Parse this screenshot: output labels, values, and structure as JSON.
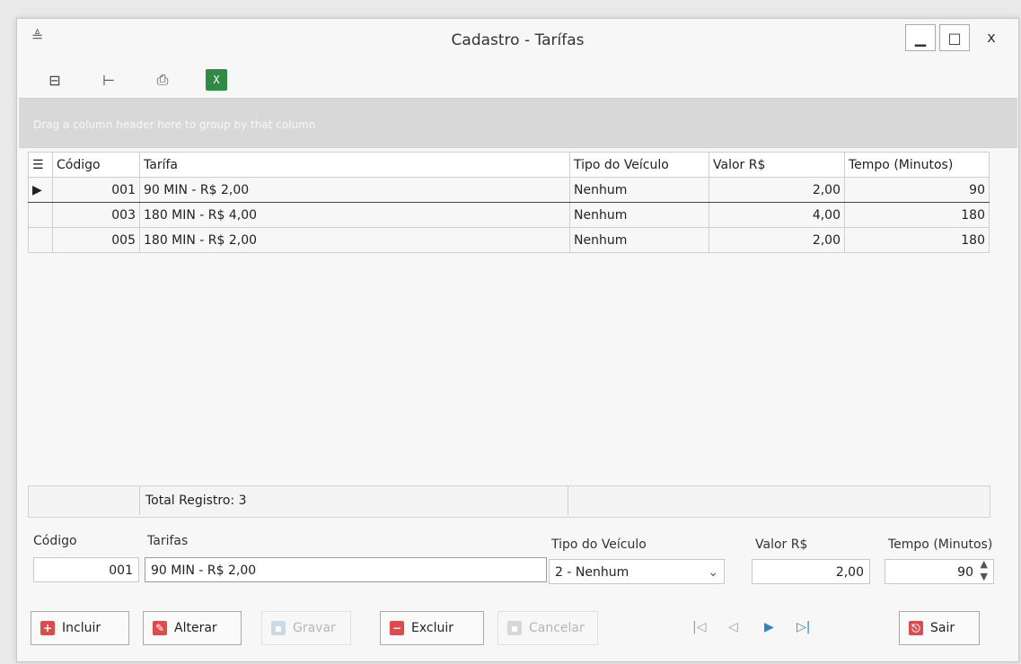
{
  "window": {
    "title": "Cadastro - Tarífas"
  },
  "toolbar": {
    "icons": [
      "tree-icon",
      "hierarchy-icon",
      "print-icon",
      "excel-icon"
    ]
  },
  "grid": {
    "group_hint": "Drag a column header here to group by that column",
    "columns": [
      "Código",
      "Tarífa",
      "Tipo do Veículo",
      "Valor R$",
      "Tempo (Minutos)"
    ],
    "rows": [
      {
        "codigo": "001",
        "tarifa": "90 MIN - R$ 2,00",
        "tipo": "Nenhum",
        "valor": "2,00",
        "tempo": "90"
      },
      {
        "codigo": "003",
        "tarifa": "180 MIN - R$ 4,00",
        "tipo": "Nenhum",
        "valor": "4,00",
        "tempo": "180"
      },
      {
        "codigo": "005",
        "tarifa": "180 MIN - R$ 2,00",
        "tipo": "Nenhum",
        "valor": "2,00",
        "tempo": "180"
      }
    ],
    "total": "Total Registro: 3"
  },
  "form": {
    "codigo_label": "Código",
    "codigo_value": "001",
    "tarifas_label": "Tarifas",
    "tarifas_value": "90 MIN - R$ 2,00",
    "tipo_label": "Tipo do Veículo",
    "tipo_value": "2 - Nenhum",
    "valor_label": "Valor R$",
    "valor_value": "2,00",
    "tempo_label": "Tempo (Minutos)",
    "tempo_value": "90"
  },
  "buttons": {
    "incluir": "Incluir",
    "alterar": "Alterar",
    "gravar": "Gravar",
    "excluir": "Excluir",
    "cancelar": "Cancelar",
    "sair": "Sair"
  },
  "colors": {
    "accent": "#2a86c9",
    "danger": "#e04a4a",
    "excel": "#2e8b44"
  }
}
